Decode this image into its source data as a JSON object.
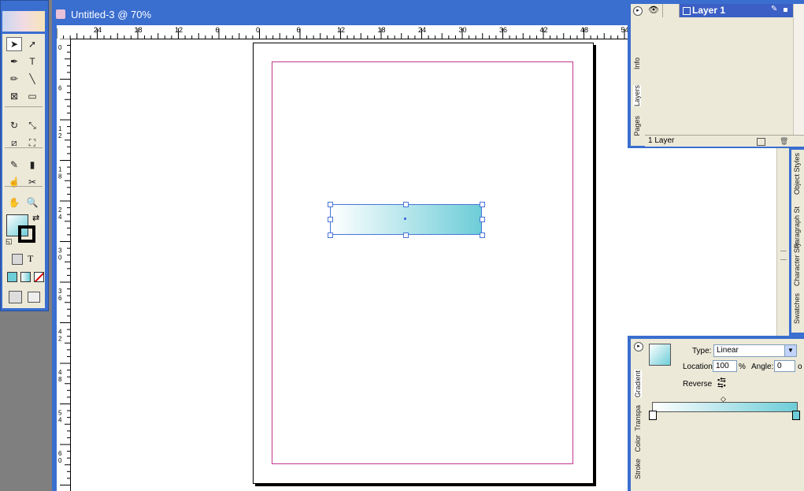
{
  "document": {
    "title": "Untitled-3 @ 70%",
    "horizontal_ruler_labels": [
      "24",
      "18",
      "12",
      "6",
      "0",
      "6",
      "12",
      "18",
      "24",
      "30",
      "36",
      "42",
      "48",
      "54"
    ],
    "vertical_ruler_labels": [
      "0",
      "6",
      "1\n2",
      "1\n8",
      "2\n4",
      "3\n0",
      "3\n6",
      "4\n2",
      "4\n8",
      "5\n4",
      "6\n0",
      "6"
    ]
  },
  "tools": {
    "items": [
      {
        "name": "selection-tool",
        "glyph": "➤"
      },
      {
        "name": "direct-selection-tool",
        "glyph": "➚"
      },
      {
        "name": "pen-tool",
        "glyph": "✒"
      },
      {
        "name": "type-tool",
        "glyph": "T"
      },
      {
        "name": "pencil-tool",
        "glyph": "✏"
      },
      {
        "name": "line-tool",
        "glyph": "╲"
      },
      {
        "name": "rectangle-frame-tool",
        "glyph": "⊠"
      },
      {
        "name": "rectangle-tool",
        "glyph": "▭"
      },
      {
        "name": "rotate-tool",
        "glyph": "↻"
      },
      {
        "name": "scale-tool",
        "glyph": "⤡"
      },
      {
        "name": "shear-tool",
        "glyph": "⧄"
      },
      {
        "name": "free-transform-tool",
        "glyph": "⛶"
      },
      {
        "name": "eyedropper-tool",
        "glyph": "✎"
      },
      {
        "name": "gradient-tool",
        "glyph": "▮"
      },
      {
        "name": "button-tool",
        "glyph": "☝"
      },
      {
        "name": "scissors-tool",
        "glyph": "✂"
      },
      {
        "name": "hand-tool",
        "glyph": "✋"
      },
      {
        "name": "zoom-tool",
        "glyph": "🔍"
      }
    ],
    "format_text_glyph": "T"
  },
  "layers_panel": {
    "tabs": [
      "Info",
      "Layers",
      "Pages"
    ],
    "layer_name": "Layer 1",
    "footer_count": "1 Layer"
  },
  "side_tabs": [
    "Object Styles",
    "Paragraph St",
    "Character Sty",
    "Swatches"
  ],
  "gradient_panel": {
    "tabs": [
      "Gradient",
      "Transpa",
      "Color",
      "Stroke"
    ],
    "type_label": "Type:",
    "type_value": "Linear",
    "location_label": "Location:",
    "location_value": "100",
    "percent": "%",
    "angle_label": "Angle:",
    "angle_value": "0",
    "angle_unit": "o",
    "reverse_label": "Reverse",
    "start_color": "#ffffff",
    "end_color": "#6dcdd8"
  }
}
